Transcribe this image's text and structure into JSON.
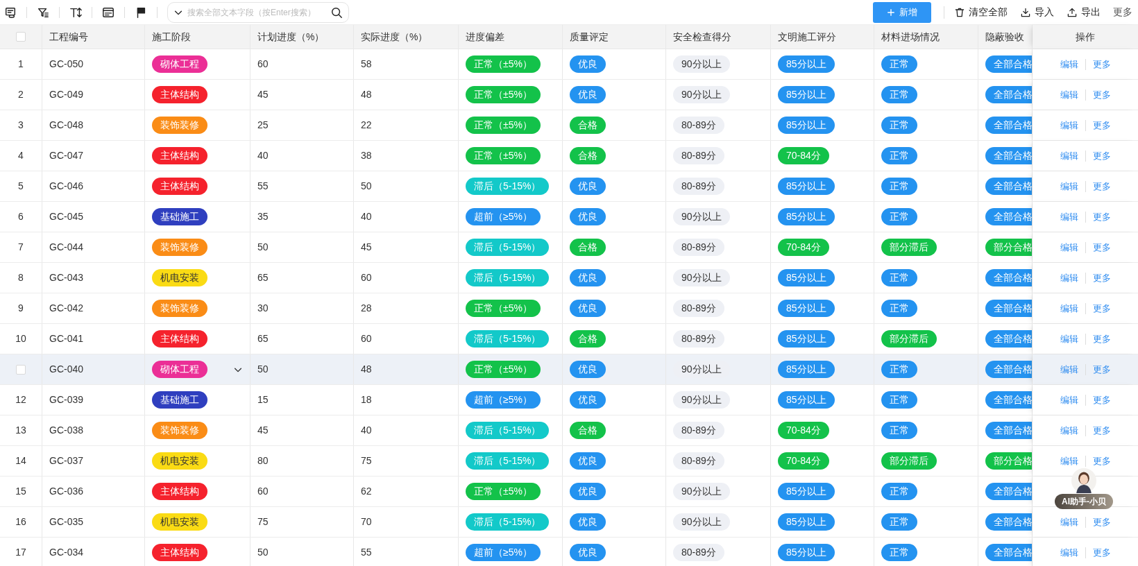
{
  "toolbar": {
    "search": {
      "placeholder": "搜索全部文本字段（按Enter搜索）"
    },
    "buttons": [
      {
        "kind": "primary",
        "label": "新增"
      },
      {
        "kind": "clear",
        "label": "清空全部"
      },
      {
        "kind": "import",
        "label": "导入"
      },
      {
        "kind": "export",
        "label": "导出"
      },
      {
        "kind": "more",
        "label": "更多"
      }
    ]
  },
  "table": {
    "select_all": {
      "checked": false
    },
    "columns": [
      "工程编号",
      "施工阶段",
      "计划进度（%）",
      "实际进度（%）",
      "进度偏差",
      "质量评定",
      "安全检查得分",
      "文明施工评分",
      "材料进场情况",
      "隐蔽验收",
      "操作"
    ],
    "rows": [
      {
        "index": "1",
        "hovered": false,
        "code": "GC-050",
        "stage": {
          "text": "砌体工程",
          "color": "#eb2f96"
        },
        "planned": "60",
        "actual": "58",
        "tags": [
          {
            "text": "正常（±5%）",
            "color": "#13c24a"
          },
          {
            "text": "优良",
            "color": "#2493f0"
          },
          {
            "text": "90分以上",
            "color": "#eef0f5"
          },
          {
            "text": "85分以上",
            "color": "#2493f0"
          },
          {
            "text": "正常",
            "color": "#2493f0"
          },
          {
            "text": "全部合格",
            "color": "#2493f0"
          }
        ],
        "actions": [
          "编辑",
          "更多"
        ]
      },
      {
        "index": "2",
        "hovered": false,
        "code": "GC-049",
        "stage": {
          "text": "主体结构",
          "color": "#f5222d"
        },
        "planned": "45",
        "actual": "48",
        "tags": [
          {
            "text": "正常（±5%）",
            "color": "#13c24a"
          },
          {
            "text": "优良",
            "color": "#2493f0"
          },
          {
            "text": "90分以上",
            "color": "#eef0f5"
          },
          {
            "text": "85分以上",
            "color": "#2493f0"
          },
          {
            "text": "正常",
            "color": "#2493f0"
          },
          {
            "text": "全部合格",
            "color": "#2493f0"
          }
        ],
        "actions": [
          "编辑",
          "更多"
        ]
      },
      {
        "index": "3",
        "hovered": false,
        "code": "GC-048",
        "stage": {
          "text": "装饰装修",
          "color": "#fa8c16"
        },
        "planned": "25",
        "actual": "22",
        "tags": [
          {
            "text": "正常（±5%）",
            "color": "#13c24a"
          },
          {
            "text": "合格",
            "color": "#13c24a"
          },
          {
            "text": "80-89分",
            "color": "#eef0f5"
          },
          {
            "text": "85分以上",
            "color": "#2493f0"
          },
          {
            "text": "正常",
            "color": "#2493f0"
          },
          {
            "text": "全部合格",
            "color": "#2493f0"
          }
        ],
        "actions": [
          "编辑",
          "更多"
        ]
      },
      {
        "index": "4",
        "hovered": false,
        "code": "GC-047",
        "stage": {
          "text": "主体结构",
          "color": "#f5222d"
        },
        "planned": "40",
        "actual": "38",
        "tags": [
          {
            "text": "正常（±5%）",
            "color": "#13c24a"
          },
          {
            "text": "合格",
            "color": "#13c24a"
          },
          {
            "text": "80-89分",
            "color": "#eef0f5"
          },
          {
            "text": "70-84分",
            "color": "#13c24a"
          },
          {
            "text": "正常",
            "color": "#2493f0"
          },
          {
            "text": "全部合格",
            "color": "#2493f0"
          }
        ],
        "actions": [
          "编辑",
          "更多"
        ]
      },
      {
        "index": "5",
        "hovered": false,
        "code": "GC-046",
        "stage": {
          "text": "主体结构",
          "color": "#f5222d"
        },
        "planned": "55",
        "actual": "50",
        "tags": [
          {
            "text": "滞后（5-15%）",
            "color": "#13c9c9"
          },
          {
            "text": "优良",
            "color": "#2493f0"
          },
          {
            "text": "80-89分",
            "color": "#eef0f5"
          },
          {
            "text": "85分以上",
            "color": "#2493f0"
          },
          {
            "text": "正常",
            "color": "#2493f0"
          },
          {
            "text": "全部合格",
            "color": "#2493f0"
          }
        ],
        "actions": [
          "编辑",
          "更多"
        ]
      },
      {
        "index": "6",
        "hovered": false,
        "code": "GC-045",
        "stage": {
          "text": "基础施工",
          "color": "#2f3fbf"
        },
        "planned": "35",
        "actual": "40",
        "tags": [
          {
            "text": "超前（≥5%）",
            "color": "#2493f0"
          },
          {
            "text": "优良",
            "color": "#2493f0"
          },
          {
            "text": "90分以上",
            "color": "#eef0f5"
          },
          {
            "text": "85分以上",
            "color": "#2493f0"
          },
          {
            "text": "正常",
            "color": "#2493f0"
          },
          {
            "text": "全部合格",
            "color": "#2493f0"
          }
        ],
        "actions": [
          "编辑",
          "更多"
        ]
      },
      {
        "index": "7",
        "hovered": false,
        "code": "GC-044",
        "stage": {
          "text": "装饰装修",
          "color": "#fa8c16"
        },
        "planned": "50",
        "actual": "45",
        "tags": [
          {
            "text": "滞后（5-15%）",
            "color": "#13c9c9"
          },
          {
            "text": "合格",
            "color": "#13c24a"
          },
          {
            "text": "80-89分",
            "color": "#eef0f5"
          },
          {
            "text": "70-84分",
            "color": "#13c24a"
          },
          {
            "text": "部分滞后",
            "color": "#13c24a"
          },
          {
            "text": "部分合格",
            "color": "#13c24a"
          }
        ],
        "actions": [
          "编辑",
          "更多"
        ]
      },
      {
        "index": "8",
        "hovered": false,
        "code": "GC-043",
        "stage": {
          "text": "机电安装",
          "color": "#fadb14"
        },
        "planned": "65",
        "actual": "60",
        "tags": [
          {
            "text": "滞后（5-15%）",
            "color": "#13c9c9"
          },
          {
            "text": "优良",
            "color": "#2493f0"
          },
          {
            "text": "90分以上",
            "color": "#eef0f5"
          },
          {
            "text": "85分以上",
            "color": "#2493f0"
          },
          {
            "text": "正常",
            "color": "#2493f0"
          },
          {
            "text": "全部合格",
            "color": "#2493f0"
          }
        ],
        "actions": [
          "编辑",
          "更多"
        ]
      },
      {
        "index": "9",
        "hovered": false,
        "code": "GC-042",
        "stage": {
          "text": "装饰装修",
          "color": "#fa8c16"
        },
        "planned": "30",
        "actual": "28",
        "tags": [
          {
            "text": "正常（±5%）",
            "color": "#13c24a"
          },
          {
            "text": "优良",
            "color": "#2493f0"
          },
          {
            "text": "80-89分",
            "color": "#eef0f5"
          },
          {
            "text": "85分以上",
            "color": "#2493f0"
          },
          {
            "text": "正常",
            "color": "#2493f0"
          },
          {
            "text": "全部合格",
            "color": "#2493f0"
          }
        ],
        "actions": [
          "编辑",
          "更多"
        ]
      },
      {
        "index": "10",
        "hovered": false,
        "code": "GC-041",
        "stage": {
          "text": "主体结构",
          "color": "#f5222d"
        },
        "planned": "65",
        "actual": "60",
        "tags": [
          {
            "text": "滞后（5-15%）",
            "color": "#13c9c9"
          },
          {
            "text": "合格",
            "color": "#13c24a"
          },
          {
            "text": "80-89分",
            "color": "#eef0f5"
          },
          {
            "text": "85分以上",
            "color": "#2493f0"
          },
          {
            "text": "部分滞后",
            "color": "#13c24a"
          },
          {
            "text": "全部合格",
            "color": "#2493f0"
          }
        ],
        "actions": [
          "编辑",
          "更多"
        ]
      },
      {
        "hovered": true,
        "code": "GC-040",
        "stage": {
          "text": "砌体工程",
          "color": "#eb2f96"
        },
        "planned": "50",
        "actual": "48",
        "tags": [
          {
            "text": "正常（±5%）",
            "color": "#13c24a"
          },
          {
            "text": "优良",
            "color": "#2493f0"
          },
          {
            "text": "90分以上",
            "color": "#eef0f5"
          },
          {
            "text": "85分以上",
            "color": "#2493f0"
          },
          {
            "text": "正常",
            "color": "#2493f0"
          },
          {
            "text": "全部合格",
            "color": "#2493f0"
          }
        ],
        "actions": [
          "编辑",
          "更多"
        ]
      },
      {
        "index": "12",
        "hovered": false,
        "code": "GC-039",
        "stage": {
          "text": "基础施工",
          "color": "#2f3fbf"
        },
        "planned": "15",
        "actual": "18",
        "tags": [
          {
            "text": "超前（≥5%）",
            "color": "#2493f0"
          },
          {
            "text": "优良",
            "color": "#2493f0"
          },
          {
            "text": "90分以上",
            "color": "#eef0f5"
          },
          {
            "text": "85分以上",
            "color": "#2493f0"
          },
          {
            "text": "正常",
            "color": "#2493f0"
          },
          {
            "text": "全部合格",
            "color": "#2493f0"
          }
        ],
        "actions": [
          "编辑",
          "更多"
        ]
      },
      {
        "index": "13",
        "hovered": false,
        "code": "GC-038",
        "stage": {
          "text": "装饰装修",
          "color": "#fa8c16"
        },
        "planned": "45",
        "actual": "40",
        "tags": [
          {
            "text": "滞后（5-15%）",
            "color": "#13c9c9"
          },
          {
            "text": "合格",
            "color": "#13c24a"
          },
          {
            "text": "80-89分",
            "color": "#eef0f5"
          },
          {
            "text": "70-84分",
            "color": "#13c24a"
          },
          {
            "text": "正常",
            "color": "#2493f0"
          },
          {
            "text": "全部合格",
            "color": "#2493f0"
          }
        ],
        "actions": [
          "编辑",
          "更多"
        ]
      },
      {
        "index": "14",
        "hovered": false,
        "code": "GC-037",
        "stage": {
          "text": "机电安装",
          "color": "#fadb14"
        },
        "planned": "80",
        "actual": "75",
        "tags": [
          {
            "text": "滞后（5-15%）",
            "color": "#13c9c9"
          },
          {
            "text": "优良",
            "color": "#2493f0"
          },
          {
            "text": "80-89分",
            "color": "#eef0f5"
          },
          {
            "text": "70-84分",
            "color": "#13c24a"
          },
          {
            "text": "部分滞后",
            "color": "#13c24a"
          },
          {
            "text": "部分合格",
            "color": "#13c24a"
          }
        ],
        "actions": [
          "编辑",
          "更多"
        ]
      },
      {
        "index": "15",
        "hovered": false,
        "code": "GC-036",
        "stage": {
          "text": "主体结构",
          "color": "#f5222d"
        },
        "planned": "60",
        "actual": "62",
        "tags": [
          {
            "text": "正常（±5%）",
            "color": "#13c24a"
          },
          {
            "text": "优良",
            "color": "#2493f0"
          },
          {
            "text": "90分以上",
            "color": "#eef0f5"
          },
          {
            "text": "85分以上",
            "color": "#2493f0"
          },
          {
            "text": "正常",
            "color": "#2493f0"
          },
          {
            "text": "全部合格",
            "color": "#2493f0"
          }
        ]
      },
      {
        "index": "16",
        "hovered": false,
        "code": "GC-035",
        "stage": {
          "text": "机电安装",
          "color": "#fadb14"
        },
        "planned": "75",
        "actual": "70",
        "tags": [
          {
            "text": "滞后（5-15%）",
            "color": "#13c9c9"
          },
          {
            "text": "优良",
            "color": "#2493f0"
          },
          {
            "text": "90分以上",
            "color": "#eef0f5"
          },
          {
            "text": "85分以上",
            "color": "#2493f0"
          },
          {
            "text": "正常",
            "color": "#2493f0"
          },
          {
            "text": "全部合格",
            "color": "#2493f0"
          }
        ],
        "actions": [
          "编辑",
          "更多"
        ]
      },
      {
        "index": "17",
        "hovered": false,
        "code": "GC-034",
        "stage": {
          "text": "主体结构",
          "color": "#f5222d"
        },
        "planned": "50",
        "actual": "55",
        "tags": [
          {
            "text": "超前（≥5%）",
            "color": "#2493f0"
          },
          {
            "text": "优良",
            "color": "#2493f0"
          },
          {
            "text": "80-89分",
            "color": "#eef0f5"
          },
          {
            "text": "85分以上",
            "color": "#2493f0"
          },
          {
            "text": "正常",
            "color": "#2493f0"
          },
          {
            "text": "全部合格",
            "color": "#2493f0"
          }
        ],
        "actions": [
          "编辑",
          "更多"
        ]
      }
    ]
  },
  "assistant": {
    "label": "AI助手-小贝"
  }
}
